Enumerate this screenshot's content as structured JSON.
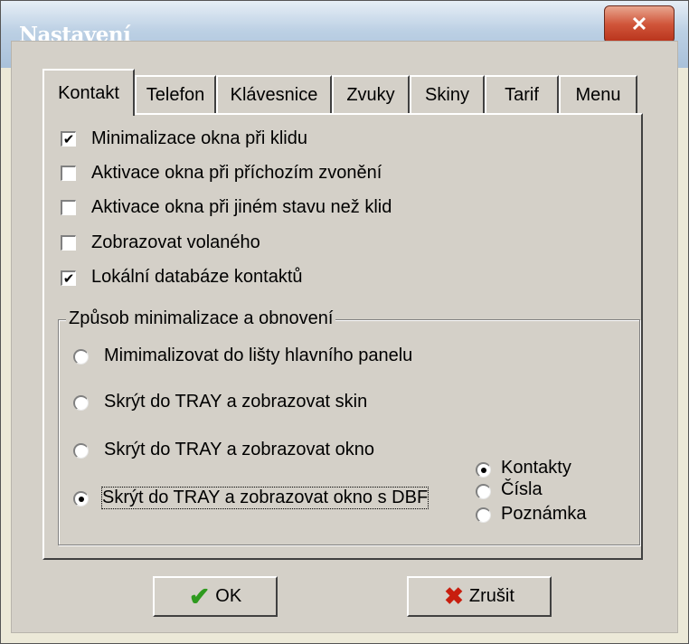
{
  "window": {
    "title": "Nastavení",
    "close_label": "✕"
  },
  "tabs": [
    {
      "label": "Kontakt",
      "active": true
    },
    {
      "label": "Telefon"
    },
    {
      "label": "Klávesnice"
    },
    {
      "label": "Zvuky"
    },
    {
      "label": "Skiny"
    },
    {
      "label": "Tarif"
    },
    {
      "label": "Menu"
    }
  ],
  "checkboxes": [
    {
      "label": "Minimalizace okna při klidu",
      "checked": true
    },
    {
      "label": "Aktivace okna při příchozím zvonění",
      "checked": false
    },
    {
      "label": "Aktivace okna při jiném stavu než klid",
      "checked": false
    },
    {
      "label": "Zobrazovat volaného",
      "checked": false
    },
    {
      "label": "Lokální databáze kontaktů",
      "checked": true
    }
  ],
  "group": {
    "title": "Způsob minimalizace a obnovení",
    "options": [
      {
        "label": "Mimimalizovat do lišty hlavního panelu",
        "selected": false
      },
      {
        "label": "Skrýt do TRAY a zobrazovat skin",
        "selected": false
      },
      {
        "label": "Skrýt do TRAY a zobrazovat okno",
        "selected": false
      },
      {
        "label": "Skrýt do TRAY a zobrazovat okno s DBF",
        "selected": true
      }
    ],
    "sub_options": [
      {
        "label": "Kontakty",
        "selected": true
      },
      {
        "label": "Čísla",
        "selected": false
      },
      {
        "label": "Poznámka",
        "selected": false
      }
    ]
  },
  "buttons": {
    "ok_label": "OK",
    "cancel_label": "Zrušit"
  },
  "colors": {
    "ok_icon": "#2e9a1e",
    "cancel_icon": "#c81e0e",
    "face": "#d4d0c8"
  },
  "icons": {
    "ok": "checkmark-icon",
    "cancel": "x-icon",
    "close": "close-icon"
  }
}
